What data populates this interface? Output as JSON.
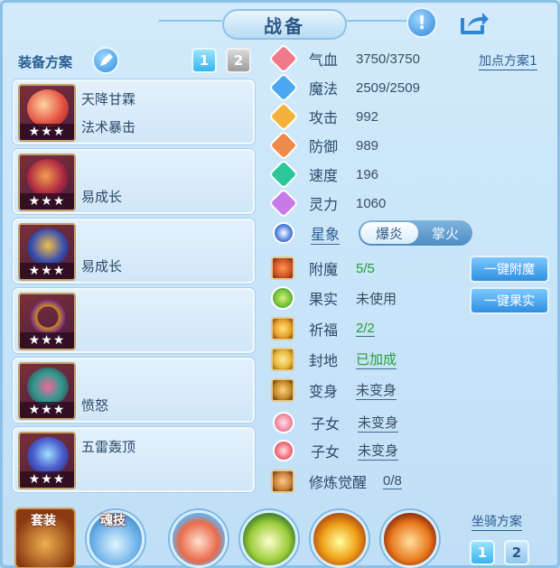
{
  "window": {
    "title": "战备"
  },
  "header": {
    "alert_icon": "alert-icon",
    "share_icon": "share-icon"
  },
  "equipment_panel": {
    "label": "装备方案",
    "edit_icon": "pencil-icon",
    "tabs": [
      "1",
      "2"
    ],
    "active_tab": "1",
    "stars": "★★★",
    "items": [
      {
        "name": "天降甘霖",
        "effect": "法术暴击",
        "icon": "scroll-brush-icon",
        "color": "#e24b3b"
      },
      {
        "name": "",
        "effect": "易成长",
        "icon": "helmet-icon",
        "color": "#b02a45"
      },
      {
        "name": "",
        "effect": "易成长",
        "icon": "armor-icon",
        "color": "#3a4fae"
      },
      {
        "name": "",
        "effect": "",
        "icon": "necklace-icon",
        "color": "#c48a2a"
      },
      {
        "name": "",
        "effect": "愤怒",
        "icon": "belt-icon",
        "color": "#2f9a8f"
      },
      {
        "name": "五雷轰顶",
        "effect": "",
        "icon": "boots-icon",
        "color": "#4a5fd0"
      }
    ]
  },
  "stats": {
    "add_point_label": "加点方案1",
    "rows": [
      {
        "name": "气血",
        "value": "3750/3750",
        "icon": "heart-icon",
        "color": "#f07a8a"
      },
      {
        "name": "魔法",
        "value": "2509/2509",
        "icon": "mana-icon",
        "color": "#4aa8f0"
      },
      {
        "name": "攻击",
        "value": "992",
        "icon": "sword-icon",
        "color": "#f2b13a"
      },
      {
        "name": "防御",
        "value": "989",
        "icon": "shield-icon",
        "color": "#f08a4a"
      },
      {
        "name": "速度",
        "value": "196",
        "icon": "speed-icon",
        "color": "#2cc69a"
      },
      {
        "name": "灵力",
        "value": "1060",
        "icon": "spirit-icon",
        "color": "#c77ae8"
      }
    ],
    "star_label": "星象",
    "star_options": [
      "爆炎",
      "掌火"
    ],
    "star_selected": "爆炎"
  },
  "attributes": [
    {
      "name": "附魔",
      "value": "5/5",
      "icon": "enchant-icon",
      "color": "#d2542a",
      "green": true
    },
    {
      "name": "果实",
      "value": "未使用",
      "icon": "fruit-icon",
      "color": "#6bbf3a",
      "green": false
    },
    {
      "name": "祈福",
      "value": "2/2",
      "icon": "blessing-icon",
      "color": "#e6a12a",
      "green": true
    },
    {
      "name": "封地",
      "value": "已加成",
      "icon": "fief-icon",
      "color": "#e6b93a",
      "green": true
    },
    {
      "name": "变身",
      "value": "未变身",
      "icon": "transform-icon",
      "color": "#c58a2a",
      "green": false
    },
    {
      "name": "子女",
      "value": "未变身",
      "icon": "child-icon",
      "color": "#f08aa0",
      "green": false
    },
    {
      "name": "子女",
      "value": "未变身",
      "icon": "child-icon",
      "color": "#ef6a7a",
      "green": false
    },
    {
      "name": "修炼觉醒",
      "value": "0/8",
      "icon": "cultivation-icon",
      "color": "#c7813a",
      "green": false
    }
  ],
  "actions": {
    "enchant_button": "一键附魔",
    "fruit_button": "一键果实"
  },
  "bottom": {
    "set_label": "套装",
    "soul_label": "魂技",
    "skills": [
      {
        "icon": "fan-skill-icon",
        "color": "#e96a4a"
      },
      {
        "icon": "figure-skill-icon",
        "color": "#9ccc3a"
      },
      {
        "icon": "fire-skill-icon",
        "color": "#f0a21a"
      },
      {
        "icon": "beast-skill-icon",
        "color": "#e8781a"
      }
    ],
    "mount_label": "坐骑方案",
    "mount_tabs": [
      "1",
      "2"
    ]
  }
}
